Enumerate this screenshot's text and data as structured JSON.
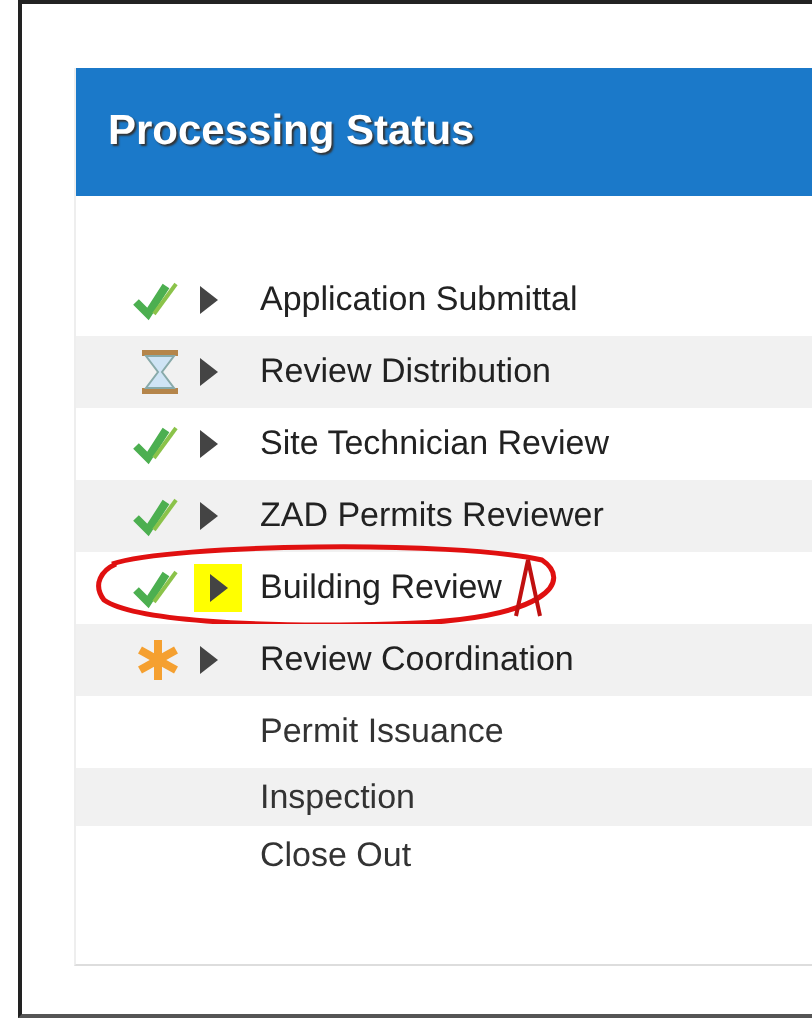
{
  "panel": {
    "title": "Processing Status"
  },
  "steps": [
    {
      "label": "Application Submittal",
      "kind": "done"
    },
    {
      "label": "Review Distribution",
      "kind": "waiting"
    },
    {
      "label": "Site Technician Review",
      "kind": "done"
    },
    {
      "label": "ZAD Permits Reviewer",
      "kind": "done"
    },
    {
      "label": "Building Review",
      "kind": "done",
      "highlighted": true,
      "circled": true
    },
    {
      "label": "Review Coordination",
      "kind": "active"
    },
    {
      "label": "Permit Issuance",
      "kind": "plain"
    },
    {
      "label": "Inspection",
      "kind": "plain"
    },
    {
      "label": "Close Out",
      "kind": "plain"
    }
  ]
}
